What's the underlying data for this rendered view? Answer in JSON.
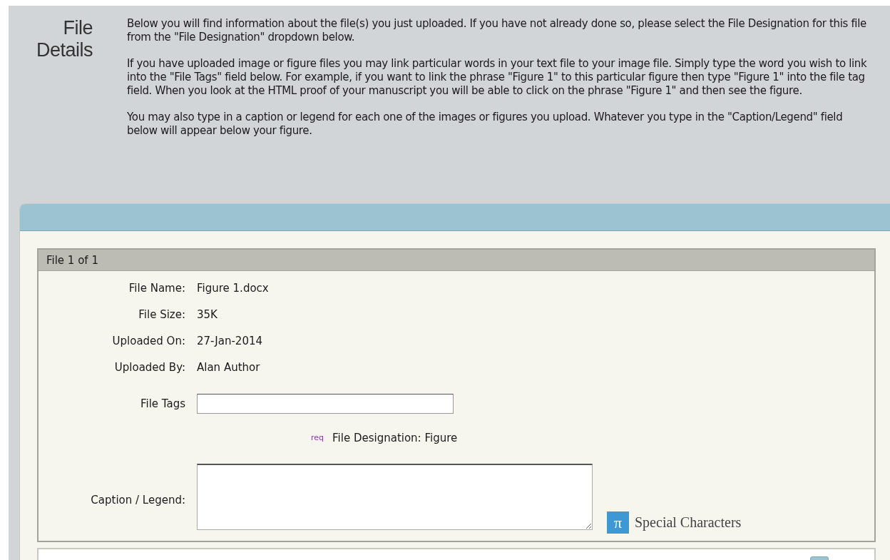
{
  "title_lines": [
    "File",
    "Details"
  ],
  "paragraphs": [
    "Below you will find information about the file(s) you just uploaded. If you have not already done so, please select the File Designation for this file from the \"File Designation\" dropdown below.",
    "If you have uploaded image or figure files you may link particular words in your text file to your image file. Simply type the word you wish to link into the \"File Tags\" field below. For example, if you want to link the phrase \"Figure 1\" to this particular figure then type \"Figure 1\" into the file tag field. When you look at the HTML proof of your manuscript you will be able to click on the phrase \"Figure 1\" and then see the figure.",
    "You may also type in a caption or legend for each one of the images or figures you upload. Whatever you type in the \"Caption/Legend\" field below will appear below your figure."
  ],
  "file_box": {
    "header": "File 1 of 1",
    "details": [
      {
        "label": "File Name:",
        "value": "Figure 1.docx"
      },
      {
        "label": "File Size:",
        "value": "35K"
      },
      {
        "label": "Uploaded On:",
        "value": "27-Jan-2014"
      },
      {
        "label": "Uploaded By:",
        "value": "Alan Author"
      }
    ],
    "tags_label": "File Tags",
    "designation": {
      "req": "req",
      "text": "File Designation: Figure"
    },
    "caption_label": "Caption / Legend:",
    "special_characters": {
      "icon": "π",
      "label": "Special Characters"
    }
  }
}
